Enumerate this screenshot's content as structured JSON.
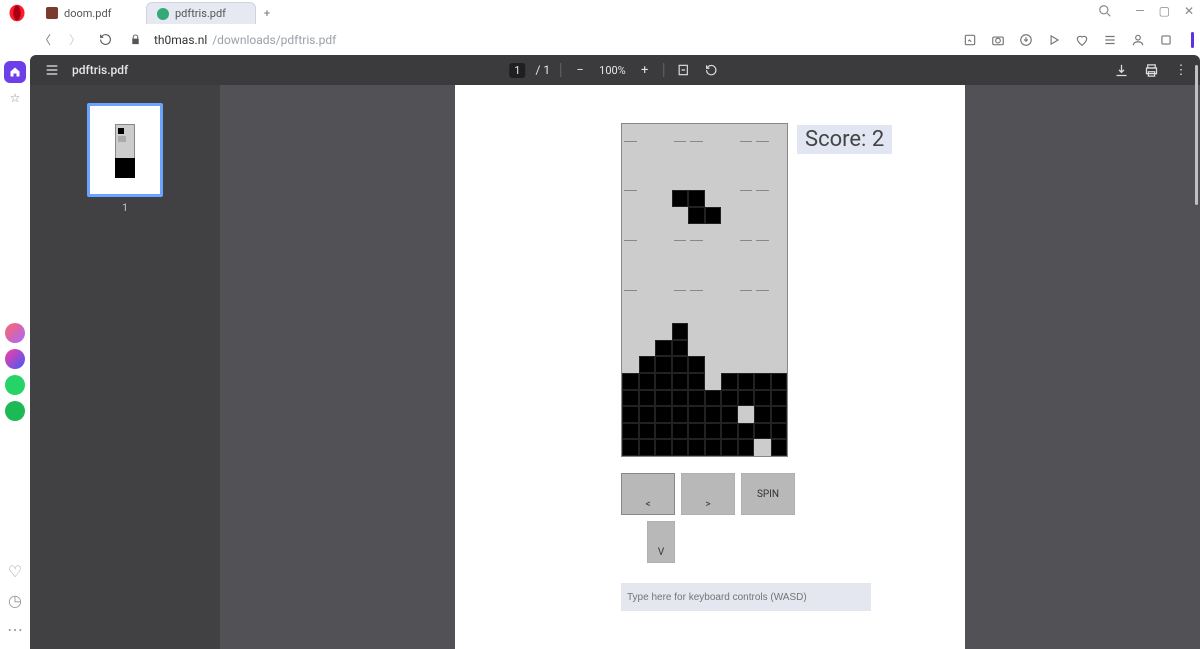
{
  "browser": {
    "tabs": [
      {
        "label": "doom.pdf",
        "active": false
      },
      {
        "label": "pdftris.pdf",
        "active": true
      }
    ],
    "url_host": "th0mas.nl",
    "url_path": "/downloads/pdftris.pdf"
  },
  "viewer": {
    "toolbar": {
      "title": "pdftris.pdf",
      "page_current": "1",
      "page_total": "1",
      "page_sep": " /  ",
      "zoom": "100%"
    },
    "thumbnail_label": "1"
  },
  "game": {
    "score_label": "Score: 2",
    "controls": {
      "left": "<",
      "right": ">",
      "spin": "SPIN",
      "down": "V"
    },
    "input_placeholder": "Type here for keyboard controls (WASD)",
    "board": {
      "cols": 10,
      "rows": 20,
      "falling": [
        [
          4,
          3
        ],
        [
          4,
          4
        ],
        [
          5,
          4
        ],
        [
          5,
          5
        ]
      ],
      "pile": [
        [
          12,
          3
        ],
        [
          13,
          2
        ],
        [
          13,
          3
        ],
        [
          14,
          1
        ],
        [
          14,
          2
        ],
        [
          14,
          3
        ],
        [
          14,
          4
        ],
        [
          15,
          0
        ],
        [
          15,
          1
        ],
        [
          15,
          2
        ],
        [
          15,
          3
        ],
        [
          15,
          4
        ],
        [
          15,
          6
        ],
        [
          15,
          7
        ],
        [
          15,
          8
        ],
        [
          15,
          9
        ],
        [
          16,
          0
        ],
        [
          16,
          1
        ],
        [
          16,
          2
        ],
        [
          16,
          3
        ],
        [
          16,
          4
        ],
        [
          16,
          5
        ],
        [
          16,
          6
        ],
        [
          16,
          7
        ],
        [
          16,
          8
        ],
        [
          16,
          9
        ],
        [
          17,
          0
        ],
        [
          17,
          1
        ],
        [
          17,
          2
        ],
        [
          17,
          3
        ],
        [
          17,
          4
        ],
        [
          17,
          5
        ],
        [
          17,
          6
        ],
        [
          17,
          8
        ],
        [
          17,
          9
        ],
        [
          18,
          0
        ],
        [
          18,
          1
        ],
        [
          18,
          2
        ],
        [
          18,
          3
        ],
        [
          18,
          4
        ],
        [
          18,
          5
        ],
        [
          18,
          6
        ],
        [
          18,
          7
        ],
        [
          18,
          8
        ],
        [
          18,
          9
        ],
        [
          19,
          0
        ],
        [
          19,
          1
        ],
        [
          19,
          2
        ],
        [
          19,
          3
        ],
        [
          19,
          4
        ],
        [
          19,
          5
        ],
        [
          19,
          6
        ],
        [
          19,
          7
        ],
        [
          19,
          9
        ]
      ],
      "hline_rows": [
        0,
        3,
        6,
        9
      ],
      "hline_pattern": [
        [
          1,
          0
        ],
        [
          0,
          1
        ],
        [
          1,
          0
        ],
        [
          0,
          1
        ],
        [
          1,
          0
        ]
      ]
    }
  }
}
